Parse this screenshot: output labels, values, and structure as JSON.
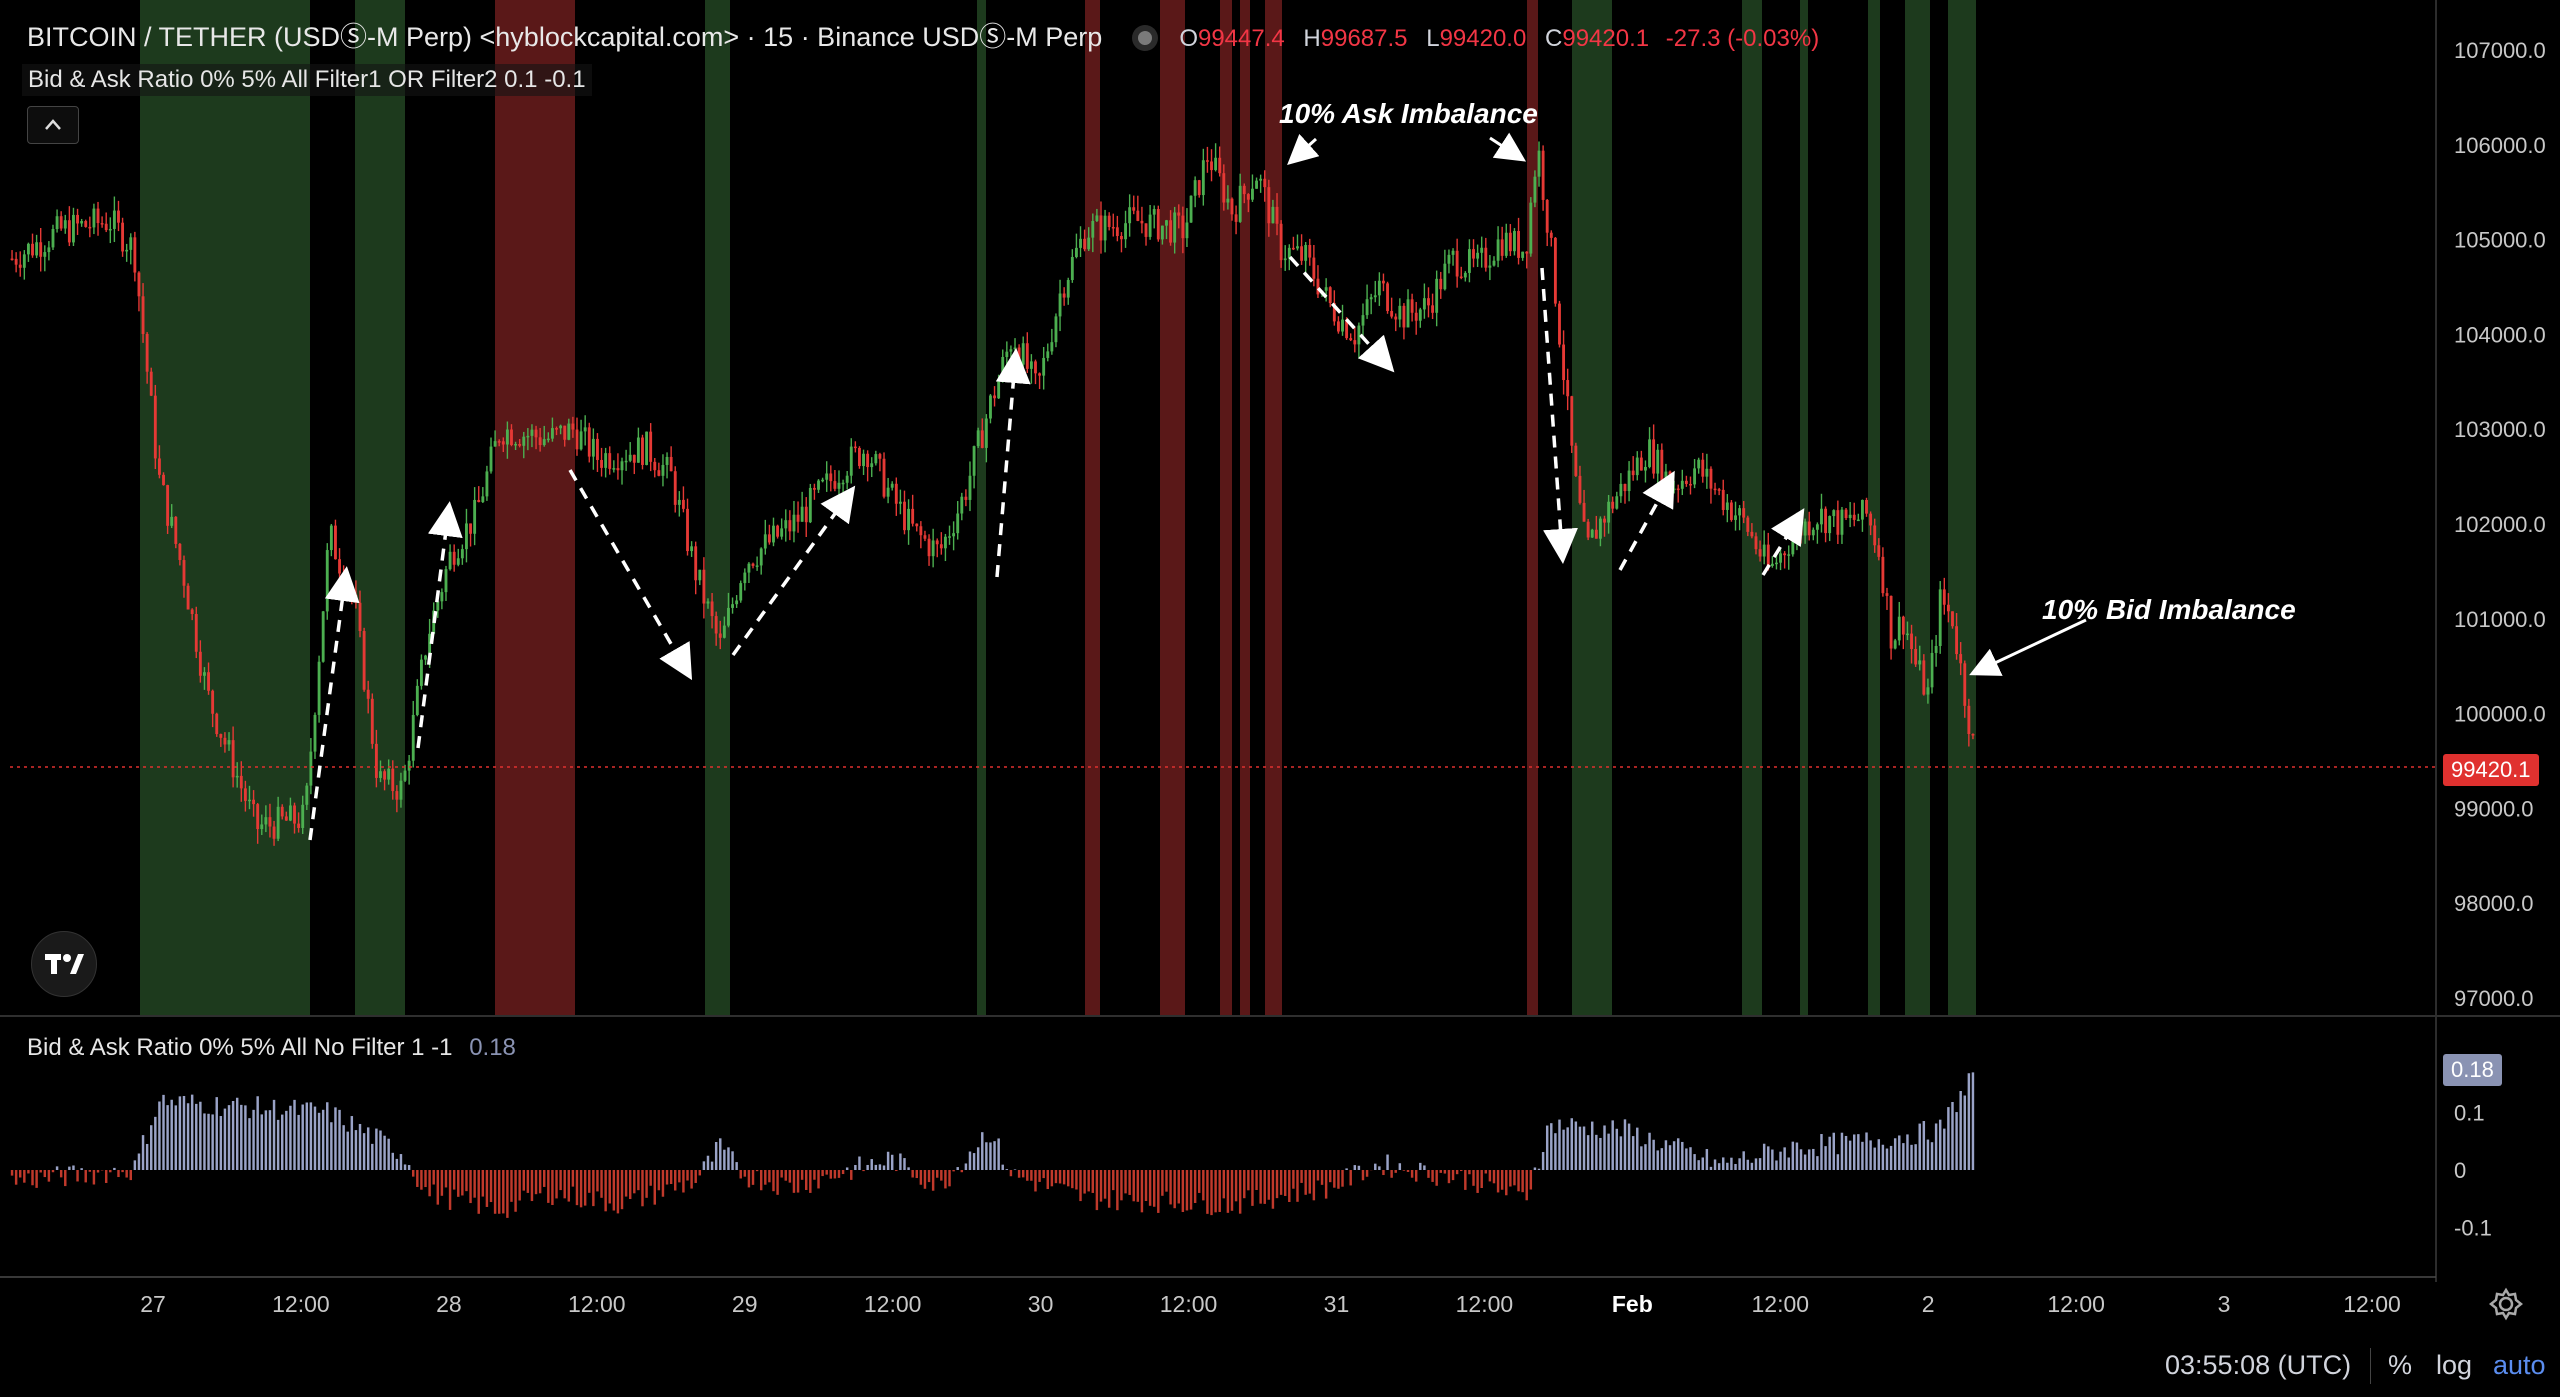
{
  "header": {
    "symbol": "BITCOIN / TETHER (USDⓈ-M Perp) <hyblockcapital.com> · 15 · Binance USDⓈ-M Perp",
    "ohlc": {
      "o": "99447.4",
      "h": "99687.5",
      "l": "99420.0",
      "c": "99420.1",
      "change": "-27.3 (-0.03%)"
    }
  },
  "indicators": {
    "top": "Bid & Ask Ratio 0% 5% All Filter1 OR Filter2 0.1 -0.1",
    "bottom": "Bid & Ask Ratio 0% 5% All No Filter 1 -1",
    "bottom_value": "0.18"
  },
  "annotations": {
    "ask": "10% Ask Imbalance",
    "bid": "10% Bid Imbalance"
  },
  "price_axis": {
    "labels": [
      "107000.0",
      "106000.0",
      "105000.0",
      "104000.0",
      "103000.0",
      "102000.0",
      "101000.0",
      "100000.0",
      "99000.0",
      "98000.0",
      "97000.0"
    ],
    "current": "99420.1"
  },
  "osc_axis": {
    "labels": [
      "0.1",
      "0",
      "-0.1"
    ],
    "current": "0.18"
  },
  "time_axis": {
    "labels": [
      "27",
      "12:00",
      "28",
      "12:00",
      "29",
      "12:00",
      "30",
      "12:00",
      "31",
      "12:00",
      "Feb",
      "12:00",
      "2",
      "12:00",
      "3",
      "12:00"
    ]
  },
  "footer": {
    "clock": "03:55:08 (UTC)",
    "percent": "%",
    "log": "log",
    "auto": "auto"
  },
  "colors": {
    "up": "#4caf50",
    "down": "#e53935",
    "bid_zone": "#1d3a1d",
    "ask_zone": "#5a1818",
    "osc_pos": "#9aa3c7",
    "osc_neg": "#c0392b",
    "accent": "#5b8def"
  },
  "chart_data": {
    "type": "candlestick",
    "timeframe": "15",
    "ylim": [
      96800,
      107300
    ],
    "path_points": [
      [
        0,
        104800
      ],
      [
        0.02,
        105100
      ],
      [
        0.04,
        105200
      ],
      [
        0.05,
        104900
      ],
      [
        0.06,
        102500
      ],
      [
        0.07,
        101500
      ],
      [
        0.08,
        100200
      ],
      [
        0.09,
        99500
      ],
      [
        0.1,
        98800
      ],
      [
        0.12,
        98900
      ],
      [
        0.13,
        101900
      ],
      [
        0.14,
        101200
      ],
      [
        0.15,
        99300
      ],
      [
        0.16,
        99200
      ],
      [
        0.17,
        100800
      ],
      [
        0.18,
        101700
      ],
      [
        0.19,
        102100
      ],
      [
        0.2,
        103000
      ],
      [
        0.22,
        102900
      ],
      [
        0.23,
        103000
      ],
      [
        0.24,
        102700
      ],
      [
        0.26,
        102800
      ],
      [
        0.27,
        102500
      ],
      [
        0.28,
        101500
      ],
      [
        0.29,
        100700
      ],
      [
        0.3,
        101600
      ],
      [
        0.32,
        102000
      ],
      [
        0.34,
        102600
      ],
      [
        0.35,
        102800
      ],
      [
        0.36,
        102300
      ],
      [
        0.37,
        101900
      ],
      [
        0.38,
        101700
      ],
      [
        0.39,
        102300
      ],
      [
        0.4,
        103200
      ],
      [
        0.41,
        104000
      ],
      [
        0.42,
        103400
      ],
      [
        0.43,
        104500
      ],
      [
        0.44,
        105100
      ],
      [
        0.46,
        105200
      ],
      [
        0.48,
        105100
      ],
      [
        0.49,
        105900
      ],
      [
        0.5,
        105300
      ],
      [
        0.51,
        105700
      ],
      [
        0.52,
        104900
      ],
      [
        0.53,
        104800
      ],
      [
        0.54,
        104300
      ],
      [
        0.55,
        104000
      ],
      [
        0.56,
        104500
      ],
      [
        0.57,
        104200
      ],
      [
        0.58,
        104300
      ],
      [
        0.59,
        104800
      ],
      [
        0.6,
        104700
      ],
      [
        0.61,
        105000
      ],
      [
        0.62,
        104900
      ],
      [
        0.625,
        106000
      ],
      [
        0.63,
        105000
      ],
      [
        0.64,
        102500
      ],
      [
        0.645,
        101700
      ],
      [
        0.65,
        102000
      ],
      [
        0.66,
        102400
      ],
      [
        0.67,
        102800
      ],
      [
        0.68,
        102400
      ],
      [
        0.69,
        102600
      ],
      [
        0.7,
        102300
      ],
      [
        0.71,
        102000
      ],
      [
        0.72,
        101500
      ],
      [
        0.73,
        101900
      ],
      [
        0.74,
        102100
      ],
      [
        0.75,
        102000
      ],
      [
        0.76,
        102100
      ],
      [
        0.765,
        101700
      ],
      [
        0.77,
        100800
      ],
      [
        0.775,
        101000
      ],
      [
        0.78,
        100500
      ],
      [
        0.785,
        100200
      ],
      [
        0.79,
        101200
      ],
      [
        0.795,
        101000
      ],
      [
        0.8,
        100200
      ],
      [
        0.805,
        99420
      ]
    ]
  }
}
